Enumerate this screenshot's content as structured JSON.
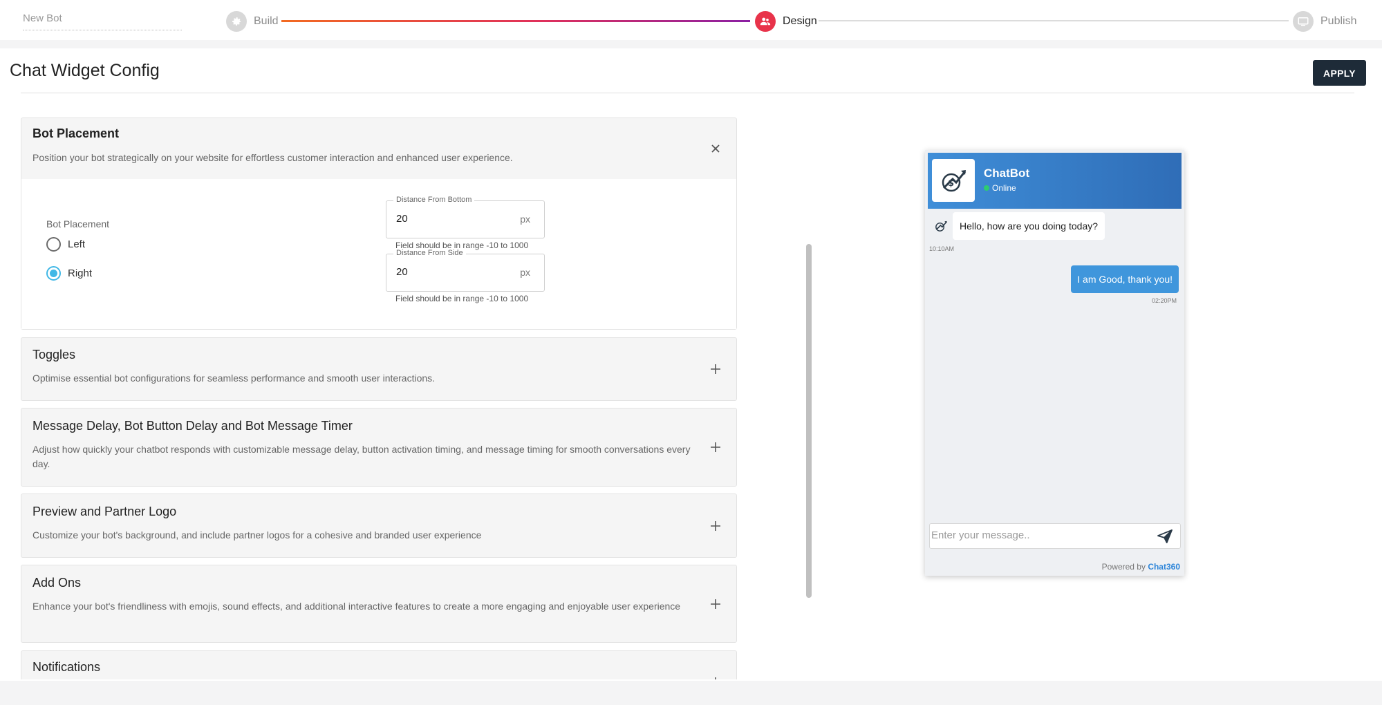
{
  "header": {
    "bot_name": "New Bot",
    "steps": [
      {
        "label": "Build",
        "state": "done"
      },
      {
        "label": "Design",
        "state": "active"
      },
      {
        "label": "Publish",
        "state": "pending"
      }
    ]
  },
  "page": {
    "title": "Chat Widget Config",
    "apply_label": "APPLY"
  },
  "sections": {
    "placement": {
      "title": "Bot Placement",
      "desc": "Position your bot strategically on your website for effortless customer interaction and enhanced user experience.",
      "radio_label": "Bot Placement",
      "options": [
        "Left",
        "Right"
      ],
      "selected": "Right",
      "bottom": {
        "label": "Distance From Bottom",
        "value": "20",
        "unit": "px",
        "help": "Field should be in range -10 to 1000"
      },
      "side": {
        "label": "Distance From Side",
        "value": "20",
        "unit": "px",
        "help": "Field should be in range -10 to 1000"
      }
    },
    "toggles": {
      "title": "Toggles",
      "desc": "Optimise essential bot configurations for seamless performance and smooth user interactions."
    },
    "delay": {
      "title": "Message Delay, Bot Button Delay and Bot Message Timer",
      "desc": "Adjust how quickly your chatbot responds with customizable message delay, button activation timing, and message timing for smooth conversations every day."
    },
    "preview": {
      "title": "Preview and Partner Logo",
      "desc": "Customize your bot's background, and include partner logos for a cohesive and branded user experience"
    },
    "addons": {
      "title": "Add Ons",
      "desc": "Enhance your bot's friendliness with emojis, sound effects, and additional interactive features to create a more engaging and enjoyable user experience"
    },
    "notifications": {
      "title": "Notifications"
    }
  },
  "chat": {
    "bot_name": "ChatBot",
    "status": "Online",
    "msg_in": "Hello, how are you doing today?",
    "time_in": "10:10AM",
    "msg_out": "I am Good, thank you!",
    "time_out": "02:20PM",
    "input_placeholder": "Enter your message..",
    "powered_prefix": "Powered by",
    "powered_brand": "Chat360"
  },
  "colors": {
    "accent_active": "#e8334a",
    "apply_bg": "#1e2b38",
    "radio_selected": "#41b8e6",
    "chat_header": "#3f8ed8",
    "bubble_out": "#3f96dc"
  }
}
